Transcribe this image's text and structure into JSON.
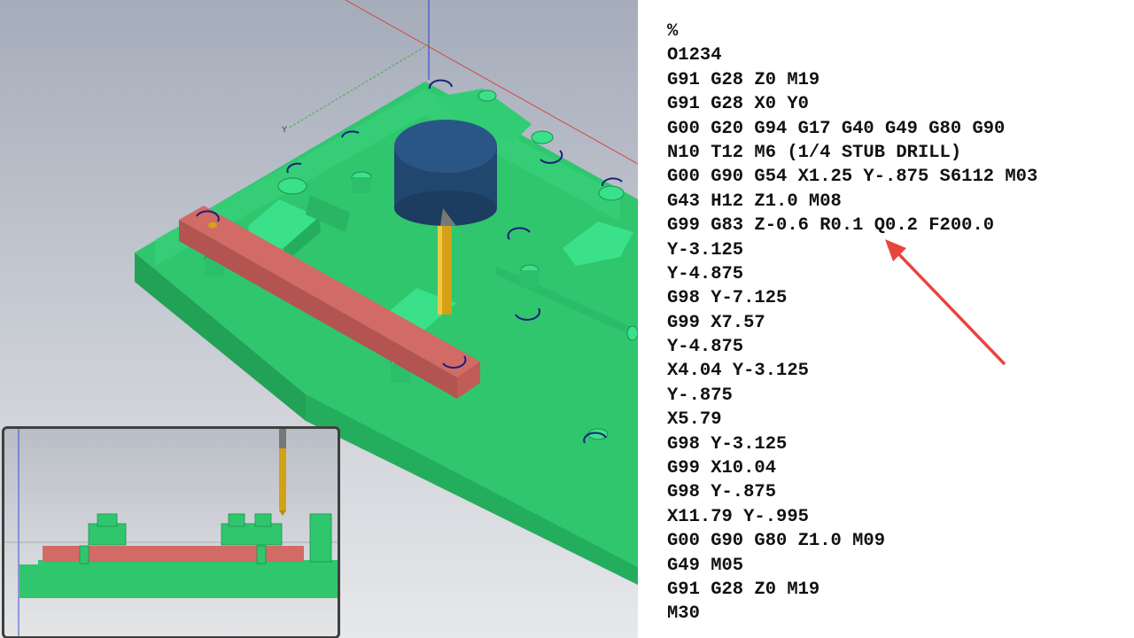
{
  "colors": {
    "fixture_plate": "#2fc66e",
    "workpiece": "#d26a66",
    "spindle": "#22476f",
    "drill": "#d4a015",
    "arrow": "#e8443e",
    "code_text": "#111111"
  },
  "viewport": {
    "axis_label_y": "Y"
  },
  "code": {
    "lines": [
      "%",
      "O1234",
      "G91 G28 Z0 M19",
      "G91 G28 X0 Y0",
      "G00 G20 G94 G17 G40 G49 G80 G90",
      "N10 T12 M6 (1/4 STUB DRILL)",
      "G00 G90 G54 X1.25 Y-.875 S6112 M03",
      "G43 H12 Z1.0 M08",
      "G99 G83 Z-0.6 R0.1 Q0.2 F200.0",
      "Y-3.125",
      "Y-4.875",
      "G98 Y-7.125",
      "G99 X7.57",
      "Y-4.875",
      "X4.04 Y-3.125",
      "Y-.875",
      "X5.79",
      "G98 Y-3.125",
      "G99 X10.04",
      "G98 Y-.875",
      "X11.79 Y-.995",
      "G00 G90 G80 Z1.0 M09",
      "G49 M05",
      "G91 G28 Z0 M19",
      "M30"
    ]
  }
}
